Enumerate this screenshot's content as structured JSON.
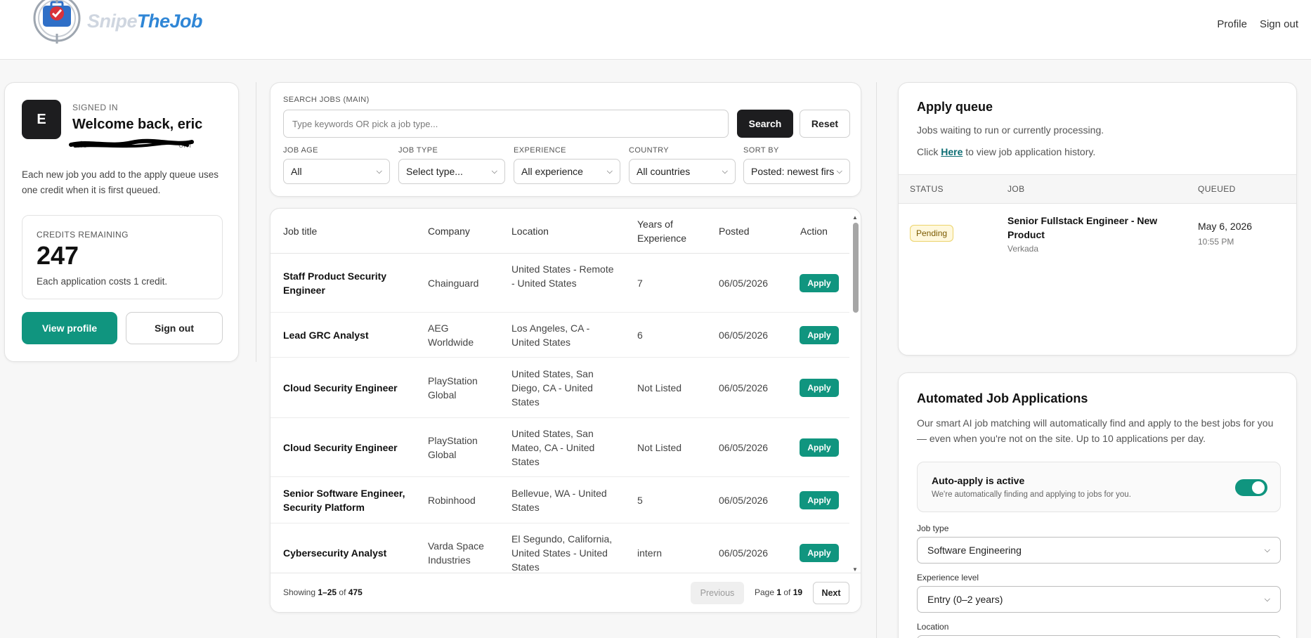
{
  "header": {
    "logo_text_a": "Snipe",
    "logo_text_b": "The",
    "logo_text_c": "Job",
    "nav": {
      "profile": "Profile",
      "sign_out": "Sign out"
    }
  },
  "profile_card": {
    "avatar_letter": "E",
    "signed_in_label": "SIGNED IN",
    "welcome": "Welcome back, eric",
    "email": "eric",
    "email_tail": "om",
    "description": "Each new job you add to the apply queue uses one credit when it is first queued.",
    "credits_label": "CREDITS REMAINING",
    "credits_value": "247",
    "credits_note": "Each application costs 1 credit.",
    "view_profile": "View profile",
    "sign_out": "Sign out"
  },
  "search": {
    "label": "SEARCH JOBS (MAIN)",
    "placeholder": "Type keywords OR pick a job type...",
    "search_button": "Search",
    "reset_button": "Reset",
    "filters": [
      {
        "label": "JOB AGE",
        "value": "All"
      },
      {
        "label": "JOB TYPE",
        "value": "Select type..."
      },
      {
        "label": "EXPERIENCE",
        "value": "All experience"
      },
      {
        "label": "COUNTRY",
        "value": "All countries"
      },
      {
        "label": "SORT BY",
        "value": "Posted: newest first"
      }
    ]
  },
  "jobs_table": {
    "columns": [
      "Job title",
      "Company",
      "Location",
      "Years of Experience",
      "Posted",
      "Action"
    ],
    "rows": [
      {
        "title": "Staff Product Security Engineer",
        "company": "Chainguard",
        "location": "United States - Remote - United States",
        "years": "7",
        "posted": "06/05/2026",
        "action": "Apply"
      },
      {
        "title": "Lead GRC Analyst",
        "company": "AEG Worldwide",
        "location": "Los Angeles, CA - United States",
        "years": "6",
        "posted": "06/05/2026",
        "action": "Apply"
      },
      {
        "title": "Cloud Security Engineer",
        "company": "PlayStation Global",
        "location": "United States, San Diego, CA - United States",
        "years": "Not Listed",
        "posted": "06/05/2026",
        "action": "Apply"
      },
      {
        "title": "Cloud Security Engineer",
        "company": "PlayStation Global",
        "location": "United States, San Mateo, CA - United States",
        "years": "Not Listed",
        "posted": "06/05/2026",
        "action": "Apply"
      },
      {
        "title": "Senior Software Engineer, Security Platform",
        "company": "Robinhood",
        "location": "Bellevue, WA - United States",
        "years": "5",
        "posted": "06/05/2026",
        "action": "Apply"
      },
      {
        "title": "Cybersecurity Analyst",
        "company": "Varda Space Industries",
        "location": "El Segundo, California, United States - United States",
        "years": "intern",
        "posted": "06/05/2026",
        "action": "Apply"
      }
    ],
    "footer": {
      "showing_prefix": "Showing ",
      "range": "1–25",
      "of_word": " of ",
      "total": "475",
      "previous": "Previous",
      "page_prefix": "Page ",
      "page": "1",
      "page_of": " of ",
      "pages": "19",
      "next": "Next"
    }
  },
  "apply_queue": {
    "title": "Apply queue",
    "subtitle": "Jobs waiting to run or currently processing.",
    "history_prefix": "Click ",
    "history_link": "Here",
    "history_suffix": " to view job application history.",
    "columns": [
      "STATUS",
      "JOB",
      "QUEUED"
    ],
    "items": [
      {
        "status": "Pending",
        "job": "Senior Fullstack Engineer - New Product",
        "company": "Verkada",
        "date": "May 6, 2026",
        "time": "10:55 PM"
      }
    ]
  },
  "automation": {
    "title": "Automated Job Applications",
    "description": "Our smart AI job matching will automatically find and apply to the best jobs for you — even when you're not on the site. Up to 10 applications per day.",
    "toggle_title": "Auto-apply is active",
    "toggle_subtitle": "We're automatically finding and applying to jobs for you.",
    "toggle_on": true,
    "job_type_label": "Job type",
    "job_type_value": "Software Engineering",
    "experience_label": "Experience level",
    "experience_value": "Entry (0–2 years)",
    "location_label": "Location"
  },
  "colors": {
    "accent": "#10957f",
    "dark": "#1d1d1f",
    "pending_bg": "#fff8dc",
    "link": "#0e6e74"
  }
}
